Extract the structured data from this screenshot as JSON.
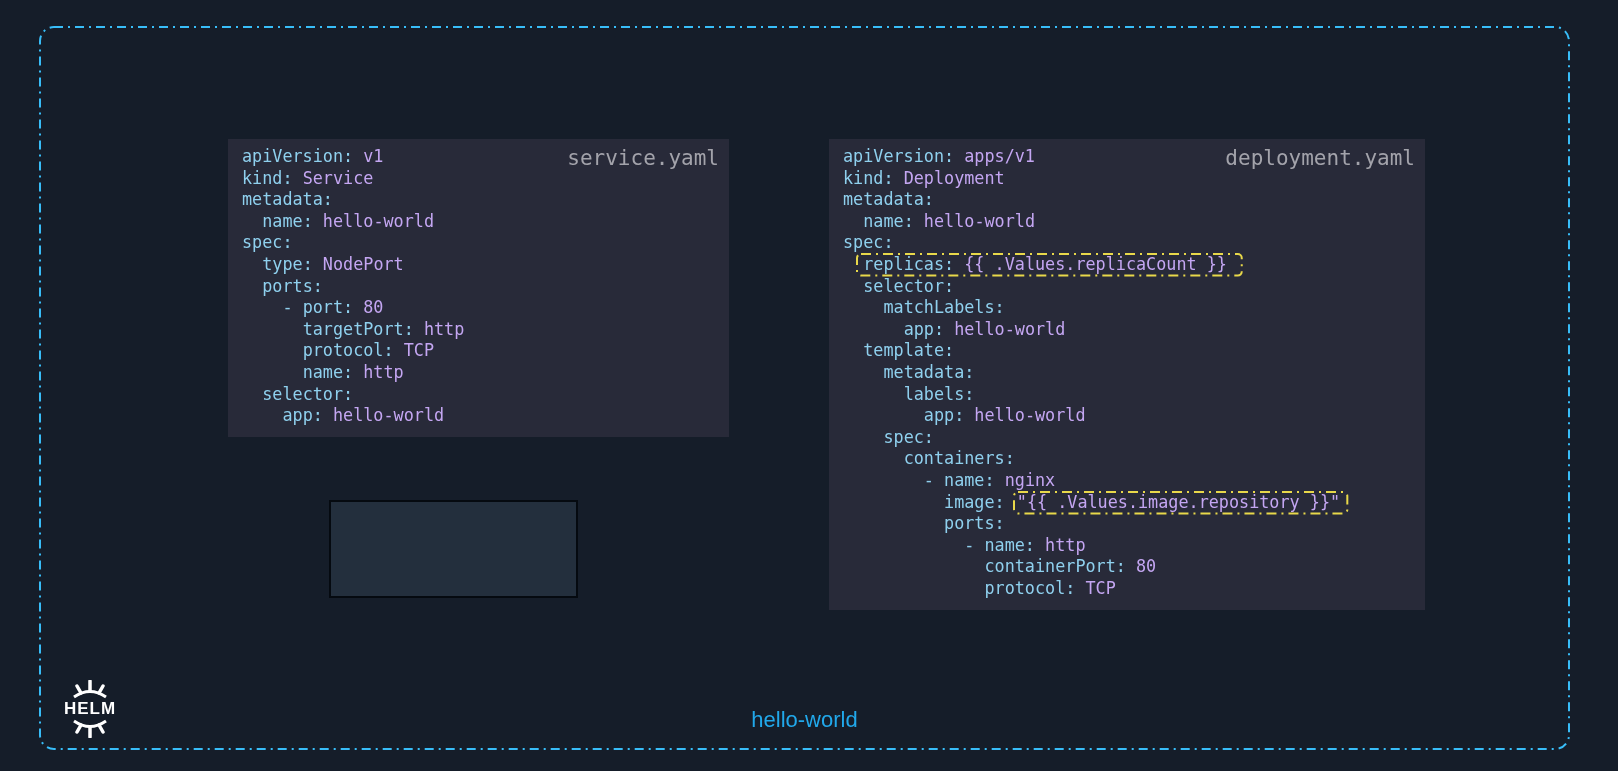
{
  "panels": [
    {
      "filename": "service.yaml",
      "lines": [
        {
          "kind": "plain",
          "key": "apiVersion:",
          "value": "v1"
        },
        {
          "kind": "plain",
          "key": "kind:",
          "value": "Service"
        },
        {
          "kind": "plain",
          "key": "metadata:"
        },
        {
          "kind": "plain",
          "key": "  name:",
          "value": "hello-world"
        },
        {
          "kind": "plain",
          "key": "spec:"
        },
        {
          "kind": "plain",
          "key": "  type:",
          "value": "NodePort"
        },
        {
          "kind": "plain",
          "key": "  ports:"
        },
        {
          "kind": "plain",
          "key": "    - port:",
          "value": "80"
        },
        {
          "kind": "plain",
          "key": "      targetPort:",
          "value": "http"
        },
        {
          "kind": "plain",
          "key": "      protocol:",
          "value": "TCP"
        },
        {
          "kind": "plain",
          "key": "      name:",
          "value": "http"
        },
        {
          "kind": "plain",
          "key": "  selector:"
        },
        {
          "kind": "plain",
          "key": "    app:",
          "value": "hello-world"
        }
      ]
    },
    {
      "filename": "deployment.yaml",
      "lines": [
        {
          "kind": "plain",
          "key": "apiVersion:",
          "value": "apps/v1"
        },
        {
          "kind": "plain",
          "key": "kind:",
          "value": "Deployment"
        },
        {
          "kind": "plain",
          "key": "metadata:"
        },
        {
          "kind": "plain",
          "key": "  name:",
          "value": "hello-world"
        },
        {
          "kind": "plain",
          "key": "spec:"
        },
        {
          "kind": "boxed",
          "key": "  replicas:",
          "value": "{{ .Values.replicaCount }}"
        },
        {
          "kind": "plain",
          "key": "  selector:"
        },
        {
          "kind": "plain",
          "key": "    matchLabels:"
        },
        {
          "kind": "plain",
          "key": "      app:",
          "value": "hello-world"
        },
        {
          "kind": "plain",
          "key": "  template:"
        },
        {
          "kind": "plain",
          "key": "    metadata:"
        },
        {
          "kind": "plain",
          "key": "      labels:"
        },
        {
          "kind": "plain",
          "key": "        app:",
          "value": "hello-world"
        },
        {
          "kind": "plain",
          "key": "    spec:"
        },
        {
          "kind": "plain",
          "key": "      containers:"
        },
        {
          "kind": "plain",
          "key": "        - name:",
          "value": "nginx"
        },
        {
          "kind": "valueboxed",
          "key": "          image:",
          "value": "\"{{ .Values.image.repository }}\""
        },
        {
          "kind": "plain",
          "key": "          ports:"
        },
        {
          "kind": "plain",
          "key": "            - name:",
          "value": "http"
        },
        {
          "kind": "plain",
          "key": "              containerPort:",
          "value": "80"
        },
        {
          "kind": "plain",
          "key": "              protocol:",
          "value": "TCP"
        }
      ]
    }
  ],
  "logo": {
    "text": "HELM"
  },
  "group_label": "hello-world"
}
